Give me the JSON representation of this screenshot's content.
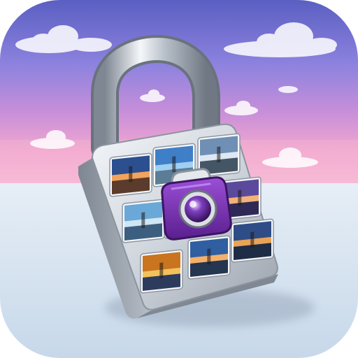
{
  "icon": {
    "name": "photo-vault-lock-app-icon",
    "glyphs": {
      "padlock": "padlock-icon",
      "camera": "camera-icon"
    },
    "colors": {
      "sky_top": "#5f63c4",
      "sky_mid": "#a58ae0",
      "sky_horizon": "#f0a6d4",
      "floor": "#d9e6f2",
      "lock_metal_light": "#e9edf2",
      "lock_metal_dark": "#8c949f",
      "camera_purple": "#7a2fb6",
      "camera_purple_dark": "#4b1b79"
    },
    "photo_tiles": [
      "sunset-coast-photo-icon",
      "blue-sky-photo-icon",
      "tower-bridge-photo-icon",
      "ocean-horizon-photo-icon",
      "lighthouse-photo-icon",
      "purple-dusk-photo-icon",
      "autumn-tree-photo-icon",
      "ship-sunset-photo-icon",
      "pier-sunset-photo-icon"
    ]
  }
}
